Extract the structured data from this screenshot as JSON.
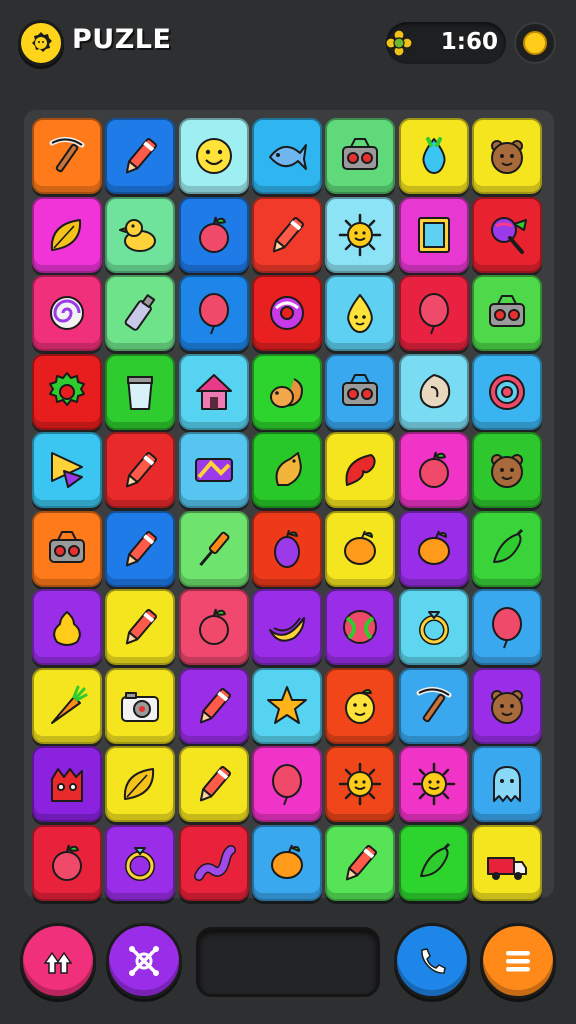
{
  "header": {
    "title": "PUZLE",
    "timer": "1:60",
    "logo_icon": "gear-face-icon",
    "timer_icon": "flower-icon",
    "coin_icon": "coin-icon"
  },
  "board": {
    "rows": 10,
    "cols": 7,
    "tiles": [
      {
        "color": "#ff7a1a",
        "icon": "pickaxe"
      },
      {
        "color": "#1e7be8",
        "icon": "crayon"
      },
      {
        "color": "#9eeef2",
        "icon": "smiley"
      },
      {
        "color": "#2fb6f0",
        "icon": "fish"
      },
      {
        "color": "#5fd97a",
        "icon": "radio"
      },
      {
        "color": "#f5e51f",
        "icon": "drop"
      },
      {
        "color": "#f5e51f",
        "icon": "bear"
      },
      {
        "color": "#f034d8",
        "icon": "leaf"
      },
      {
        "color": "#6fe39b",
        "icon": "duck"
      },
      {
        "color": "#1e7be8",
        "icon": "apple"
      },
      {
        "color": "#f23a2a",
        "icon": "crayon"
      },
      {
        "color": "#8ce3f5",
        "icon": "sun"
      },
      {
        "color": "#e838d2",
        "icon": "frame"
      },
      {
        "color": "#e8222f",
        "icon": "lollipop"
      },
      {
        "color": "#f0307a",
        "icon": "swirl"
      },
      {
        "color": "#6fe38a",
        "icon": "bottle"
      },
      {
        "color": "#1e86e8",
        "icon": "balloon"
      },
      {
        "color": "#e82020",
        "icon": "donut"
      },
      {
        "color": "#5ed0f2",
        "icon": "drop-face"
      },
      {
        "color": "#e82240",
        "icon": "balloon"
      },
      {
        "color": "#4fd94a",
        "icon": "radio"
      },
      {
        "color": "#e81e1e",
        "icon": "gear"
      },
      {
        "color": "#2ecc2e",
        "icon": "cup"
      },
      {
        "color": "#56d3f0",
        "icon": "house"
      },
      {
        "color": "#2ed42e",
        "icon": "squirrel"
      },
      {
        "color": "#3aa8ef",
        "icon": "radio"
      },
      {
        "color": "#7adcf2",
        "icon": "shell"
      },
      {
        "color": "#3ab4f0",
        "icon": "target"
      },
      {
        "color": "#3ac6f0",
        "icon": "flag"
      },
      {
        "color": "#e82a2a",
        "icon": "crayon"
      },
      {
        "color": "#56c6f0",
        "icon": "ticket"
      },
      {
        "color": "#28c828",
        "icon": "chicken"
      },
      {
        "color": "#f5e51f",
        "icon": "feather"
      },
      {
        "color": "#f034c8",
        "icon": "apple"
      },
      {
        "color": "#2ec82e",
        "icon": "bear"
      },
      {
        "color": "#ff7a1a",
        "icon": "radio"
      },
      {
        "color": "#1e7be8",
        "icon": "crayon"
      },
      {
        "color": "#6ee36e",
        "icon": "pin"
      },
      {
        "color": "#ef3a1a",
        "icon": "plum"
      },
      {
        "color": "#f5e51f",
        "icon": "lemon"
      },
      {
        "color": "#9a2ee8",
        "icon": "lemon"
      },
      {
        "color": "#3ad43a",
        "icon": "pepper"
      },
      {
        "color": "#9a2ee8",
        "icon": "pear"
      },
      {
        "color": "#f5e51f",
        "icon": "crayon"
      },
      {
        "color": "#f0486e",
        "icon": "apple"
      },
      {
        "color": "#9a2ee8",
        "icon": "banana"
      },
      {
        "color": "#9a2ee8",
        "icon": "ball"
      },
      {
        "color": "#5fd6f0",
        "icon": "ring"
      },
      {
        "color": "#3aa8ef",
        "icon": "balloon"
      },
      {
        "color": "#f5e51f",
        "icon": "carrot"
      },
      {
        "color": "#f5e51f",
        "icon": "camera"
      },
      {
        "color": "#9a2ee8",
        "icon": "crayon"
      },
      {
        "color": "#56d3f0",
        "icon": "star"
      },
      {
        "color": "#f0461a",
        "icon": "lemon-face"
      },
      {
        "color": "#3aa8ef",
        "icon": "pickaxe"
      },
      {
        "color": "#9a2ee8",
        "icon": "bear"
      },
      {
        "color": "#8a22e0",
        "icon": "monster"
      },
      {
        "color": "#f5e51f",
        "icon": "leaf"
      },
      {
        "color": "#f5e51f",
        "icon": "crayon"
      },
      {
        "color": "#f034c8",
        "icon": "balloon"
      },
      {
        "color": "#f0461a",
        "icon": "sun"
      },
      {
        "color": "#f034c8",
        "icon": "sun"
      },
      {
        "color": "#3aa8ef",
        "icon": "ghost"
      },
      {
        "color": "#e8223a",
        "icon": "apple"
      },
      {
        "color": "#9a2ee8",
        "icon": "ring"
      },
      {
        "color": "#e8223a",
        "icon": "worm"
      },
      {
        "color": "#3aa8ef",
        "icon": "lemon"
      },
      {
        "color": "#56e356",
        "icon": "crayon"
      },
      {
        "color": "#2ed42e",
        "icon": "pepper"
      },
      {
        "color": "#f5e51f",
        "icon": "truck"
      }
    ]
  },
  "footer": {
    "buttons": [
      {
        "name": "double-arrow-up-button",
        "icon": "double-arrow-up-icon",
        "color": "#f0307a"
      },
      {
        "name": "shuffle-button",
        "icon": "shuffle-icon",
        "color": "#9a2ee8"
      },
      {
        "name": "phone-button",
        "icon": "phone-icon",
        "color": "#1e86e8"
      },
      {
        "name": "menu-button",
        "icon": "menu-icon",
        "color": "#ff8a1a"
      }
    ]
  }
}
